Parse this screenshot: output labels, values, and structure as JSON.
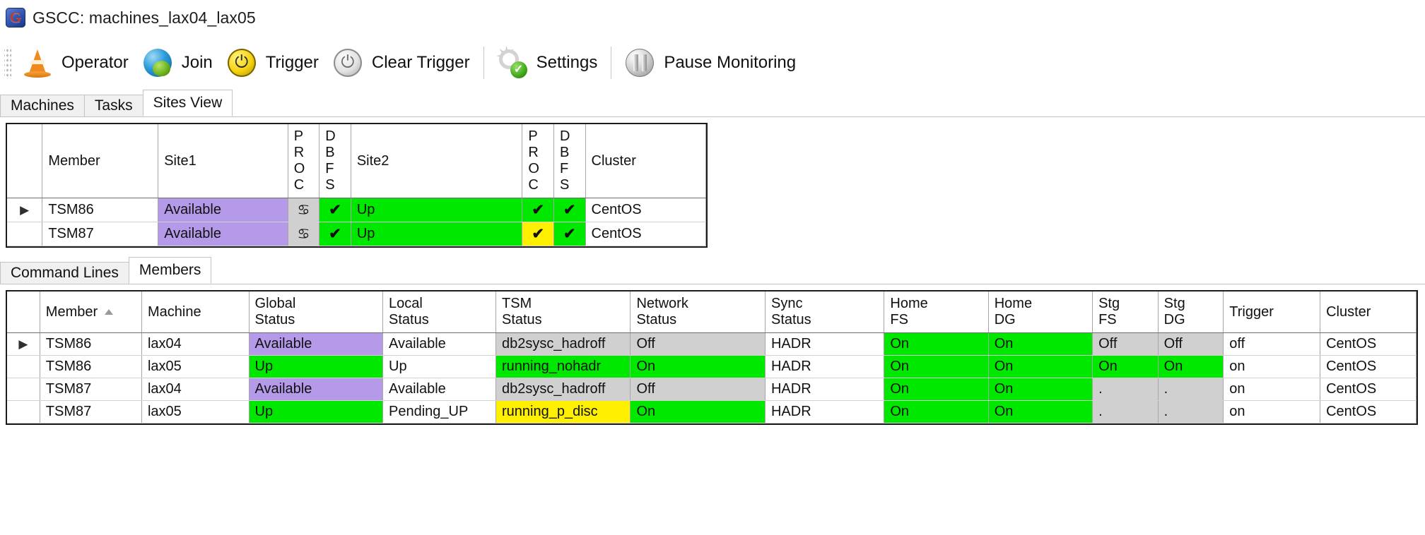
{
  "window": {
    "title": "GSCC: machines_lax04_lax05",
    "app_icon": "gscc-logo-icon"
  },
  "toolbar": {
    "items": [
      {
        "label": "Operator",
        "icon": "traffic-cone-icon"
      },
      {
        "label": "Join",
        "icon": "globe-icon"
      },
      {
        "label": "Trigger",
        "icon": "power-yellow-icon"
      },
      {
        "label": "Clear Trigger",
        "icon": "power-grey-icon"
      },
      {
        "label": "Settings",
        "icon": "gear-check-icon"
      },
      {
        "label": "Pause Monitoring",
        "icon": "pause-icon"
      }
    ]
  },
  "top_tabs": {
    "items": [
      {
        "label": "Machines",
        "active": false
      },
      {
        "label": "Tasks",
        "active": false
      },
      {
        "label": "Sites View",
        "active": true
      }
    ]
  },
  "sites_grid": {
    "headers": {
      "row_header": "",
      "member": "Member",
      "site1": "Site1",
      "site1_proc": "P\nR\nO\nC",
      "site1_dbfs": "D\nB\nF\nS",
      "site2": "Site2",
      "site2_proc": "P\nR\nO\nC",
      "site2_dbfs": "D\nB\nF\nS",
      "cluster": "Cluster"
    },
    "rows": [
      {
        "selected": true,
        "row_indicator": "▶",
        "member": "TSM86",
        "site1": "Available",
        "site1_color": "purple",
        "site1_proc": "♋",
        "site1_proc_color": "grey",
        "site1_dbfs": "✔",
        "site1_dbfs_color": "green",
        "site2": "Up",
        "site2_color": "green",
        "site2_proc": "✔",
        "site2_proc_color": "green",
        "site2_dbfs": "✔",
        "site2_dbfs_color": "green",
        "cluster": "CentOS"
      },
      {
        "selected": false,
        "row_indicator": "",
        "member": "TSM87",
        "site1": "Available",
        "site1_color": "purple",
        "site1_proc": "♋",
        "site1_proc_color": "grey",
        "site1_dbfs": "✔",
        "site1_dbfs_color": "green",
        "site2": "Up",
        "site2_color": "green",
        "site2_proc": "✔",
        "site2_proc_color": "yellow",
        "site2_dbfs": "✔",
        "site2_dbfs_color": "green",
        "cluster": "CentOS"
      }
    ]
  },
  "bottom_tabs": {
    "items": [
      {
        "label": "Command Lines",
        "active": false
      },
      {
        "label": "Members",
        "active": true
      }
    ]
  },
  "members_grid": {
    "headers": {
      "row_header": "",
      "member": "Member",
      "member_sort": "ascending",
      "machine": "Machine",
      "global_status": "Global\nStatus",
      "local_status": "Local\nStatus",
      "tsm_status": "TSM\nStatus",
      "network_status": "Network\nStatus",
      "sync_status": "Sync\nStatus",
      "home_fs": "Home\nFS",
      "home_dg": "Home\nDG",
      "stg_fs": "Stg\nFS",
      "stg_dg": "Stg\nDG",
      "trigger": "Trigger",
      "cluster": "Cluster"
    },
    "rows": [
      {
        "selected": true,
        "row_indicator": "▶",
        "member": "TSM86",
        "machine": "lax04",
        "global_status": "Available",
        "global_status_color": "purple",
        "local_status": "Available",
        "local_status_color": "white",
        "tsm_status": "db2sysc_hadroff",
        "tsm_status_color": "grey",
        "network_status": "Off",
        "network_status_color": "grey",
        "sync_status": "HADR",
        "sync_status_color": "white",
        "home_fs": "On",
        "home_fs_color": "green",
        "home_dg": "On",
        "home_dg_color": "green",
        "stg_fs": "Off",
        "stg_fs_color": "grey",
        "stg_dg": "Off",
        "stg_dg_color": "grey",
        "trigger": "off",
        "trigger_color": "white",
        "cluster": "CentOS",
        "cluster_color": "white"
      },
      {
        "selected": false,
        "row_indicator": "",
        "member": "TSM86",
        "machine": "lax05",
        "global_status": "Up",
        "global_status_color": "green",
        "local_status": "Up",
        "local_status_color": "white",
        "tsm_status": "running_nohadr",
        "tsm_status_color": "green",
        "network_status": "On",
        "network_status_color": "green",
        "sync_status": "HADR",
        "sync_status_color": "white",
        "home_fs": "On",
        "home_fs_color": "green",
        "home_dg": "On",
        "home_dg_color": "green",
        "stg_fs": "On",
        "stg_fs_color": "green",
        "stg_dg": "On",
        "stg_dg_color": "green",
        "trigger": "on",
        "trigger_color": "white",
        "cluster": "CentOS",
        "cluster_color": "white"
      },
      {
        "selected": false,
        "row_indicator": "",
        "member": "TSM87",
        "machine": "lax04",
        "global_status": "Available",
        "global_status_color": "purple",
        "local_status": "Available",
        "local_status_color": "white",
        "tsm_status": "db2sysc_hadroff",
        "tsm_status_color": "grey",
        "network_status": "Off",
        "network_status_color": "grey",
        "sync_status": "HADR",
        "sync_status_color": "white",
        "home_fs": "On",
        "home_fs_color": "green",
        "home_dg": "On",
        "home_dg_color": "green",
        "stg_fs": ".",
        "stg_fs_color": "grey",
        "stg_dg": ".",
        "stg_dg_color": "grey",
        "trigger": "on",
        "trigger_color": "white",
        "cluster": "CentOS",
        "cluster_color": "white"
      },
      {
        "selected": false,
        "row_indicator": "",
        "member": "TSM87",
        "machine": "lax05",
        "global_status": "Up",
        "global_status_color": "green",
        "local_status": "Pending_UP",
        "local_status_color": "white",
        "tsm_status": "running_p_disc",
        "tsm_status_color": "yellow",
        "network_status": "On",
        "network_status_color": "green",
        "sync_status": "HADR",
        "sync_status_color": "white",
        "home_fs": "On",
        "home_fs_color": "green",
        "home_dg": "On",
        "home_dg_color": "green",
        "stg_fs": ".",
        "stg_fs_color": "grey",
        "stg_dg": ".",
        "stg_dg_color": "grey",
        "trigger": "on",
        "trigger_color": "white",
        "cluster": "CentOS",
        "cluster_color": "white"
      }
    ]
  },
  "colors": {
    "green": "#00e800",
    "purple": "#b49ae8",
    "yellow": "#ffef00",
    "grey": "#d0d0d0",
    "white": "#ffffff"
  }
}
